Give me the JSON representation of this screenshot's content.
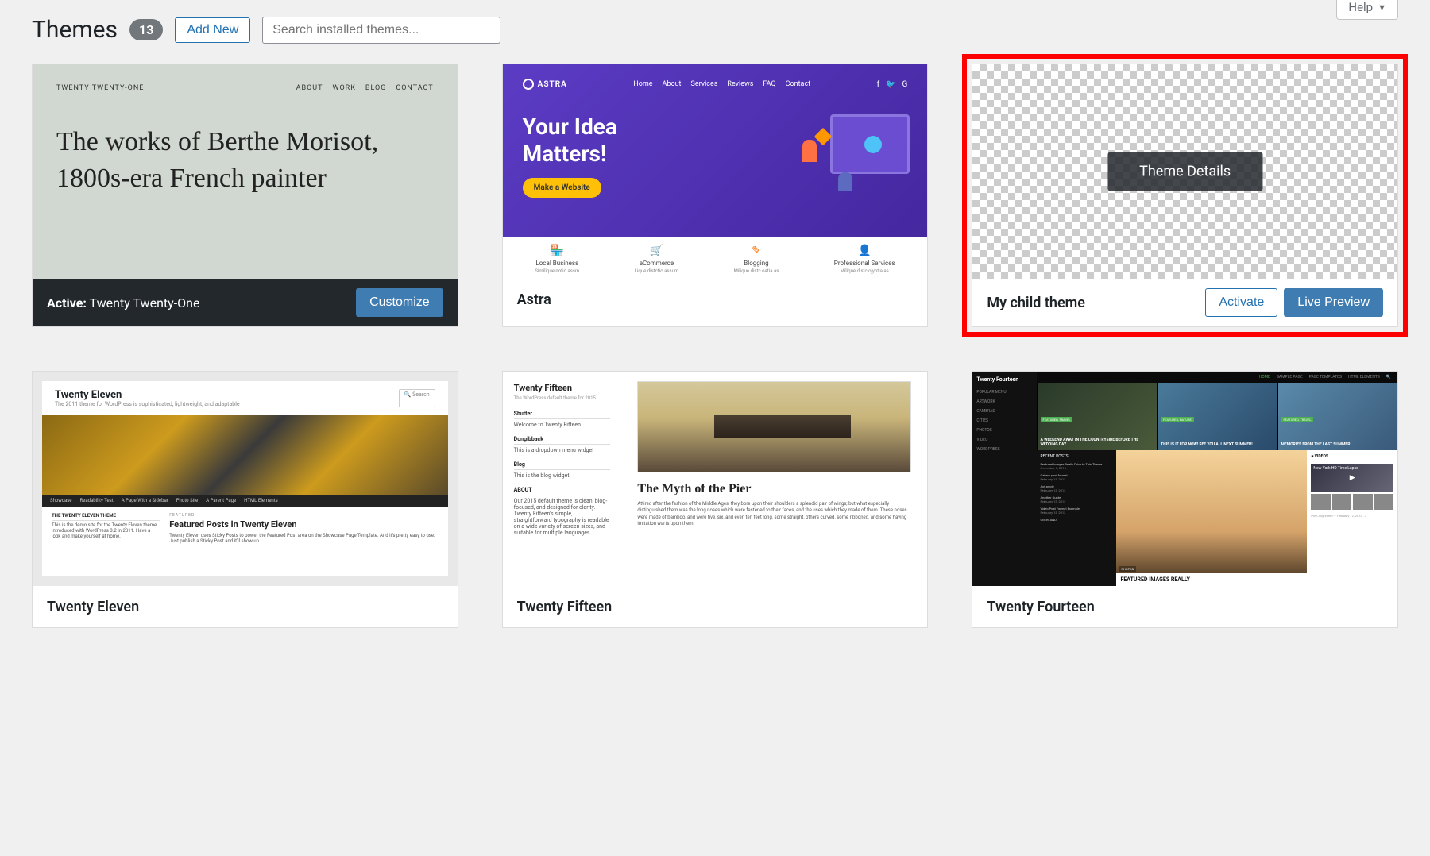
{
  "page": {
    "title": "Themes",
    "count": "13",
    "add_new": "Add New",
    "search_placeholder": "Search installed themes...",
    "help": "Help"
  },
  "themes": {
    "twenty_twenty_one": {
      "name": "Twenty Twenty-One",
      "active_label": "Active:",
      "customize": "Customize",
      "preview": {
        "site_title": "TWENTY TWENTY-ONE",
        "menu": [
          "ABOUT",
          "WORK",
          "BLOG",
          "CONTACT"
        ],
        "hero": "The works of Berthe Morisot, 1800s-era French painter"
      }
    },
    "astra": {
      "name": "Astra",
      "preview": {
        "logo": "ASTRA",
        "nav": [
          "Home",
          "About",
          "Services",
          "Reviews",
          "FAQ",
          "Contact"
        ],
        "title_l1": "Your Idea",
        "title_l2": "Matters!",
        "cta": "Make a Website",
        "feat1": "Local Business",
        "feat1_sub": "Similique notio assm",
        "feat2": "eCommerce",
        "feat2_sub": "Lique distctio assum",
        "feat3": "Blogging",
        "feat3_sub": "Milique distc oatia as",
        "feat4": "Professional Services",
        "feat4_sub": "Milique distc ojyotia as"
      }
    },
    "my_child": {
      "name": "My child theme",
      "details_btn": "Theme Details",
      "activate": "Activate",
      "live_preview": "Live Preview"
    },
    "twenty_eleven": {
      "name": "Twenty Eleven",
      "preview": {
        "title": "Twenty Eleven",
        "sub": "The 2011 theme for WordPress is sophisticated, lightweight, and adaptable",
        "search": "🔍 Search",
        "nav": [
          "Showcase",
          "Readability Test",
          "A Page With a Sidebar",
          "Photo Site",
          "A Parent Page",
          "HTML Elements"
        ],
        "left_t": "THE TWENTY ELEVEN THEME",
        "left_txt": "This is the demo site for the Twenty Eleven theme introduced with WordPress 3.2 in 2011. Have a look and make yourself at home.",
        "feat_label": "FEATURED",
        "feat_t": "Featured Posts in Twenty Eleven",
        "feat_txt": "Twenty Eleven uses Sticky Posts to power the Featured Post area on the Showcase Page Template. And it's pretty easy to use. Just publish a Sticky Post and it'll show up"
      }
    },
    "twenty_fifteen": {
      "name": "Twenty Fifteen",
      "preview": {
        "side_t": "Twenty Fifteen",
        "side_s": "The WordPress default theme for 2015.",
        "w1": "Shutter",
        "w2": "Dongibback",
        "w3": "Blog",
        "about": "ABOUT",
        "about_txt": "Our 2015 default theme is clean, blog-focused, and designed for clarity. Twenty Fifteen's simple, straightforward typography is readable on a wide variety of screen sizes, and suitable for multiple languages.",
        "title": "The Myth of the Pier",
        "text": "Attired after the fashion of the Middle Ages, they bore upon their shoulders a splendid pair of wings; but what especially distinguished them was the long noses which were fastened to their faces, and the uses which they made of them. These noses were made of bamboo, and were five, six, and even ten feet long, some straight, others curved, some ribboned, and some having imitation warts upon them."
      }
    },
    "twenty_fourteen": {
      "name": "Twenty Fourteen",
      "preview": {
        "side_t": "Twenty Fourteen",
        "side_items": [
          "POPULAR MENU",
          "ARTWORK",
          "CAMERAS",
          "CITIES",
          "PHOTOS",
          "VIDEO",
          "WORDPRESS"
        ],
        "nav": [
          "HOME",
          "SAMPLE PAGE",
          "PAGE TEMPLATES",
          "HTML ELEMENTS"
        ],
        "tag": "FEATURED, TRAVEL",
        "tag2": "FEATURED, NATURE",
        "cap1": "A WEEKEND AWAY IN THE COUNTRYSIDE BEFORE THE WEDDING DAY",
        "cap2": "THIS IS IT FOR NOW! SEE YOU ALL NEXT SUMMER!",
        "cap3": "MEMORIES FROM THE LAST SUMMER",
        "list": [
          {
            "t": "Featured Images Really Drive to This Theme",
            "d": "November 5, 2013"
          },
          {
            "t": "Gallery post format",
            "d": "February 13, 2013"
          },
          {
            "t": "Aot amde",
            "d": "February 13, 2013"
          },
          {
            "t": "Another Quote",
            "d": "February 13, 2013"
          },
          {
            "t": "Video Post Format Example",
            "d": "February 13, 2013"
          },
          {
            "t": "OBERLAND",
            "d": ""
          }
        ],
        "center_tag": "PHOTOS",
        "center_t": "FEATURED IMAGES REALLY",
        "videos_t": "VIDEOS",
        "vid1": "New York HD Time Lapse",
        "list2_t": "Post Alignment — February 12, 2013 →"
      }
    }
  }
}
